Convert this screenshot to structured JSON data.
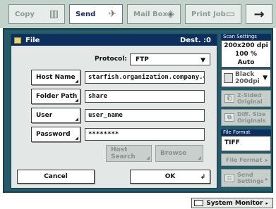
{
  "tabs": [
    {
      "label": "Copy"
    },
    {
      "label": "Send"
    },
    {
      "label": "Mail Box"
    },
    {
      "label": "Print Job"
    }
  ],
  "next_arrow": "→",
  "panel": {
    "title": "File",
    "dest": "Dest. :0",
    "protocol_label": "Protocol:",
    "protocol_value": "FTP",
    "host_name_label": "Host Name",
    "host_name_value": "starfish.organization.company.co",
    "folder_path_label": "Folder Path",
    "folder_path_value": "share",
    "user_label": "User",
    "user_value": "user_name",
    "password_label": "Password",
    "password_value": "********",
    "host_search_label": "Host Search",
    "browse_label": "Browse",
    "cancel_label": "Cancel",
    "ok_label": "OK"
  },
  "side": {
    "scan_settings_title": "Scan Settings",
    "resolution": "200x200 dpi",
    "scale": "100 %",
    "mode": "Auto",
    "color_value": "Black",
    "color_dpi": "200dpi",
    "two_sided_line1": "2-Sided",
    "two_sided_line2": "Original",
    "diff_size_line1": "Diff. Size",
    "diff_size_line2": "Originals",
    "file_format_title": "File Format",
    "file_format_value": "TIFF",
    "file_format_button": "File Format",
    "send_settings_line1": "Send",
    "send_settings_line2": "Settings"
  },
  "status": {
    "system_monitor": "System Monitor"
  }
}
